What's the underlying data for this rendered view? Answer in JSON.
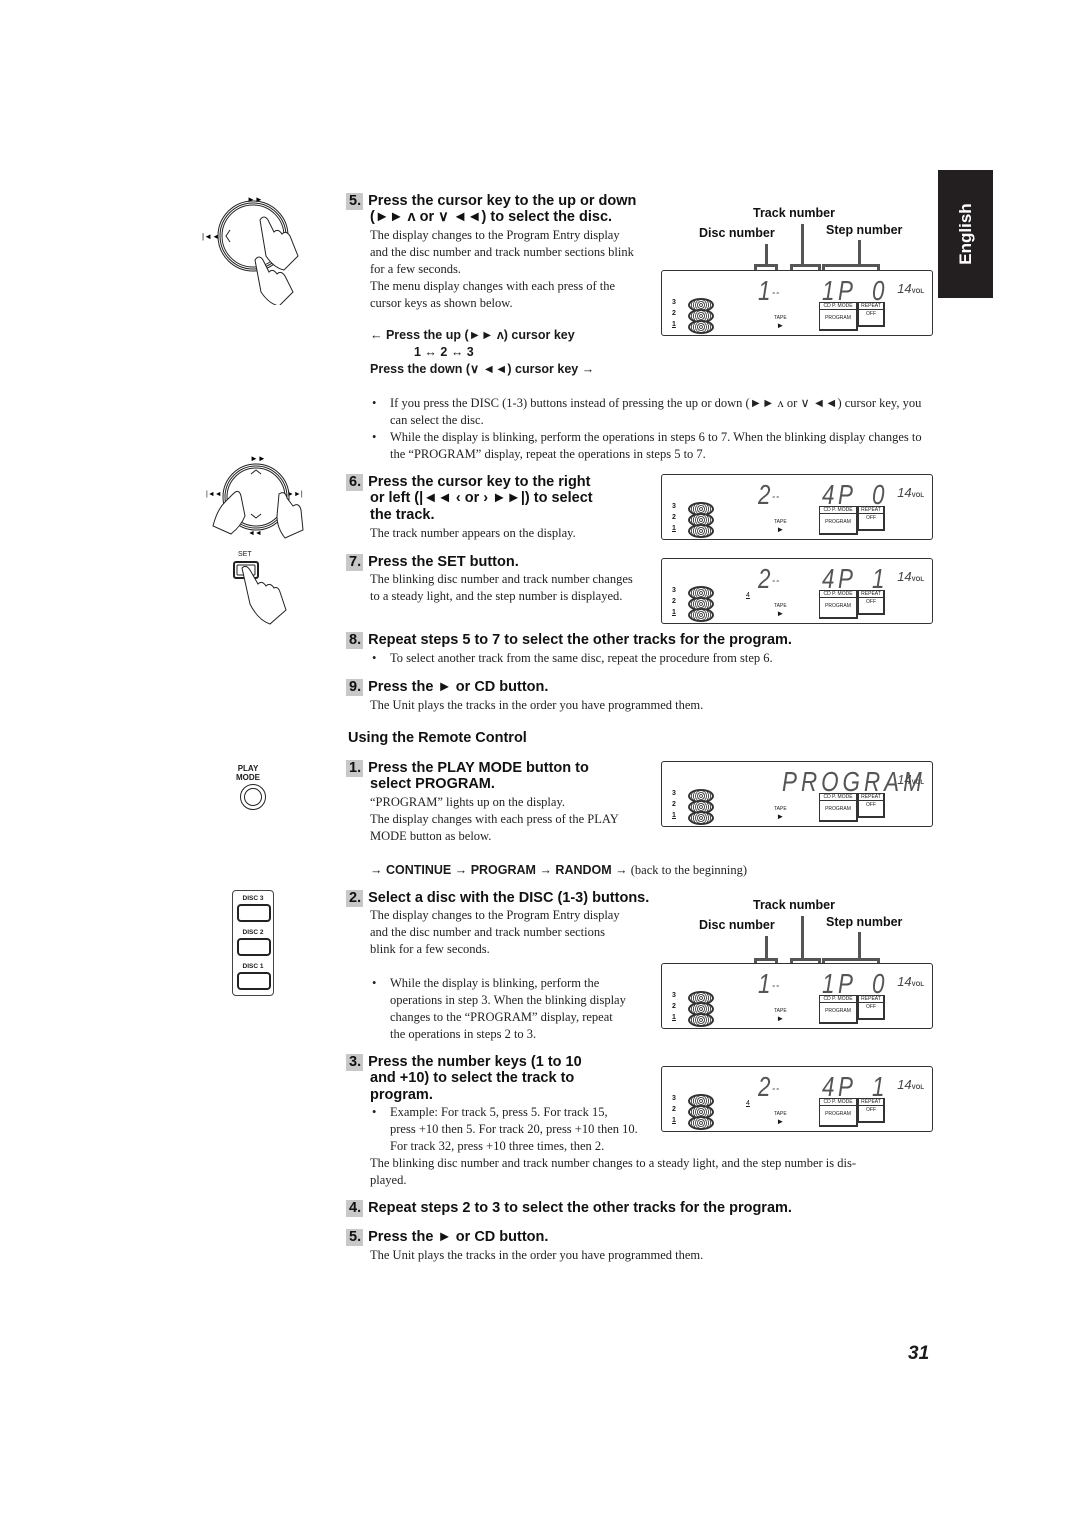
{
  "language_tab": "English",
  "page_number": "31",
  "lcd_common": {
    "vol": "14",
    "vol_unit": "VOL",
    "disc_labels": [
      "3",
      "2",
      "1"
    ],
    "tape_label": "TAPE",
    "cd_p_mode": "CD P. MODE",
    "program": "PROGRAM",
    "repeat": "REPEAT",
    "off": "OFF"
  },
  "labels": {
    "track_number": "Track number",
    "disc_number": "Disc number",
    "step_number": "Step number"
  },
  "unit_steps": {
    "step5": {
      "num": "5.",
      "title_line1": "Press the cursor key to the up or down",
      "title_line2": "(►►  ʌ or ∨ ◄◄) to select the disc.",
      "body": [
        "The display changes to the Program Entry display",
        "and the disc number and track number sections blink",
        "for a few seconds.",
        "The menu display changes with each press of the",
        "cursor keys as shown below."
      ],
      "cycle_up": "← Press the up (►►  ʌ) cursor key",
      "cycle_mid": "1 ↔ 2 ↔ 3",
      "cycle_down": "Press the down (∨ ◄◄) cursor key →",
      "display": {
        "disc": "1",
        "dash": "--",
        "track": "1",
        "p": "P",
        "step": "0",
        "mark": ""
      }
    },
    "notes": [
      "If you press the DISC (1-3) buttons instead of pressing the up or down (►► ʌ or ∨ ◄◄) cursor key, you can select the disc.",
      "While the display is blinking, perform the operations in steps 6 to 7. When the blinking display changes to the “PROGRAM” display, repeat the operations in steps 5 to 7."
    ],
    "step6": {
      "num": "6.",
      "title": [
        "Press the cursor key to the right",
        "or left (|◄◄ ‹ or › ►►|) to select",
        "the track."
      ],
      "body": "The track number appears on the display.",
      "display": {
        "disc": "2",
        "dash": "--",
        "track": "4",
        "p": "P",
        "step": "0",
        "mark": ""
      }
    },
    "step7": {
      "num": "7.",
      "title": "Press the SET button.",
      "body": [
        "The blinking disc number and track number changes",
        "to a steady light, and the step number is displayed."
      ],
      "display": {
        "disc": "2",
        "dash": "--",
        "track": "4",
        "p": "P",
        "step": "1",
        "mark": "4"
      }
    },
    "step8": {
      "num": "8.",
      "title": "Repeat steps 5 to 7 to select the other tracks for the program.",
      "note": "To select another track from the same disc, repeat the procedure from step 6."
    },
    "step9": {
      "num": "9.",
      "title": "Press the ► or CD button.",
      "body": "The Unit plays the tracks in the order you have programmed them."
    }
  },
  "remote": {
    "heading": "Using the Remote Control",
    "step1": {
      "num": "1.",
      "title": [
        "Press the PLAY MODE button to",
        "select PROGRAM."
      ],
      "body": [
        "“PROGRAM” lights up on the display.",
        "The display changes with each press of the PLAY",
        "MODE button as below."
      ],
      "cycle": "→ CONTINUE → PROGRAM → RANDOM  →",
      "cycle_tail": " (back to the beginning)",
      "display_text": "PROGRAM"
    },
    "step2": {
      "num": "2.",
      "title": "Select a disc with the DISC (1-3) buttons.",
      "body": [
        "The display changes to the Program Entry display",
        "and the disc number and track number sections",
        "blink for a few seconds."
      ],
      "note": [
        "While the display is blinking, perform the",
        "operations in step 3. When the blinking display",
        "changes to the “PROGRAM” display, repeat",
        "the operations in steps 2 to 3."
      ],
      "display": {
        "disc": "1",
        "dash": "--",
        "track": "1",
        "p": "P",
        "step": "0",
        "mark": ""
      }
    },
    "step3": {
      "num": "3.",
      "title": [
        "Press the number keys (1 to 10",
        "and +10) to select the track to",
        "program."
      ],
      "example": [
        "Example: For track 5, press 5. For track 15,",
        "press +10 then 5. For track 20, press +10 then 10.",
        "For track 32, press +10 three times, then 2."
      ],
      "body": [
        "The blinking disc number and track number changes to a steady light, and the step number is dis-",
        "played."
      ],
      "display": {
        "disc": "2",
        "dash": "--",
        "track": "4",
        "p": "P",
        "step": "1",
        "mark": "4"
      }
    },
    "step4": {
      "num": "4.",
      "title": "Repeat steps 2 to 3 to select the other tracks for the program."
    },
    "step5": {
      "num": "5.",
      "title": "Press the ► or CD button.",
      "body": "The Unit plays the tracks in the order you have programmed them."
    }
  },
  "remote_buttons": {
    "play_mode": [
      "PLAY",
      "MODE"
    ],
    "set": "SET",
    "discs": [
      "DISC 3",
      "DISC 2",
      "DISC 1"
    ]
  },
  "icons": {
    "jog_dial": "jog-dial-hand-icon",
    "cursor_pad": "cursor-pad-hands-icon",
    "set_button": "set-button-hand-icon"
  }
}
